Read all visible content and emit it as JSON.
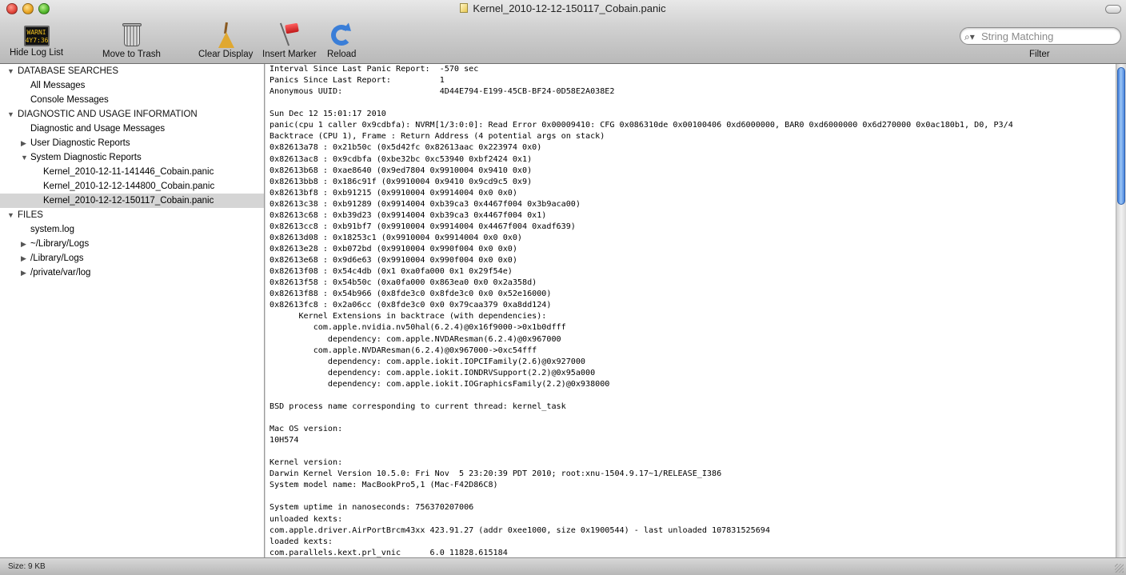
{
  "window": {
    "title": "Kernel_2010-12-12-150117_Cobain.panic"
  },
  "toolbar": {
    "buttons": [
      {
        "label": "Hide Log List",
        "icon": "warning-log-icon",
        "icon_text": "WARNI\n4Y7:36"
      },
      {
        "label": "Move to Trash",
        "icon": "trash-icon"
      },
      {
        "label": "Clear Display",
        "icon": "broom-icon"
      },
      {
        "label": "Insert Marker",
        "icon": "flag-icon"
      },
      {
        "label": "Reload",
        "icon": "reload-icon"
      }
    ],
    "search": {
      "placeholder": "String Matching",
      "value": ""
    },
    "filter_label": "Filter"
  },
  "sidebar": {
    "rows": [
      {
        "label": "DATABASE SEARCHES",
        "kind": "header",
        "expanded": true
      },
      {
        "label": "All Messages",
        "kind": "item"
      },
      {
        "label": "Console Messages",
        "kind": "item"
      },
      {
        "label": "DIAGNOSTIC AND USAGE INFORMATION",
        "kind": "header",
        "expanded": true
      },
      {
        "label": "Diagnostic and Usage Messages",
        "kind": "item"
      },
      {
        "label": "User Diagnostic Reports",
        "kind": "group",
        "expanded": false
      },
      {
        "label": "System Diagnostic Reports",
        "kind": "group",
        "expanded": true
      },
      {
        "label": "Kernel_2010-12-11-141446_Cobain.panic",
        "kind": "file"
      },
      {
        "label": "Kernel_2010-12-12-144800_Cobain.panic",
        "kind": "file"
      },
      {
        "label": "Kernel_2010-12-12-150117_Cobain.panic",
        "kind": "file",
        "selected": true
      },
      {
        "label": "FILES",
        "kind": "header",
        "expanded": true
      },
      {
        "label": "system.log",
        "kind": "item"
      },
      {
        "label": "~/Library/Logs",
        "kind": "group",
        "expanded": false
      },
      {
        "label": "/Library/Logs",
        "kind": "group",
        "expanded": false
      },
      {
        "label": "/private/var/log",
        "kind": "group",
        "expanded": false
      }
    ]
  },
  "log": {
    "lines": [
      "Interval Since Last Panic Report:  -570 sec",
      "Panics Since Last Report:          1",
      "Anonymous UUID:                    4D44E794-E199-45CB-BF24-0D58E2A038E2",
      "",
      "Sun Dec 12 15:01:17 2010",
      "panic(cpu 1 caller 0x9cdbfa): NVRM[1/3:0:0]: Read Error 0x00009410: CFG 0x086310de 0x00100406 0xd6000000, BAR0 0xd6000000 0x6d270000 0x0ac180b1, D0, P3/4",
      "Backtrace (CPU 1), Frame : Return Address (4 potential args on stack)",
      "0x82613a78 : 0x21b50c (0x5d42fc 0x82613aac 0x223974 0x0)",
      "0x82613ac8 : 0x9cdbfa (0xbe32bc 0xc53940 0xbf2424 0x1)",
      "0x82613b68 : 0xae8640 (0x9ed7804 0x9910004 0x9410 0x0)",
      "0x82613bb8 : 0x186c91f (0x9910004 0x9410 0x9cd9c5 0x9)",
      "0x82613bf8 : 0xb91215 (0x9910004 0x9914004 0x0 0x0)",
      "0x82613c38 : 0xb91289 (0x9914004 0xb39ca3 0x4467f004 0x3b9aca00)",
      "0x82613c68 : 0xb39d23 (0x9914004 0xb39ca3 0x4467f004 0x1)",
      "0x82613cc8 : 0xb91bf7 (0x9910004 0x9914004 0x4467f004 0xadf639)",
      "0x82613d08 : 0x18253c1 (0x9910004 0x9914004 0x0 0x0)",
      "0x82613e28 : 0xb072bd (0x9910004 0x990f004 0x0 0x0)",
      "0x82613e68 : 0x9d6e63 (0x9910004 0x990f004 0x0 0x0)",
      "0x82613f08 : 0x54c4db (0x1 0xa0fa000 0x1 0x29f54e)",
      "0x82613f58 : 0x54b50c (0xa0fa000 0x863ea0 0x0 0x2a358d)",
      "0x82613f88 : 0x54b966 (0x8fde3c0 0x8fde3c0 0x0 0x52e16000)",
      "0x82613fc8 : 0x2a06cc (0x8fde3c0 0x0 0x79caa379 0xa8dd124)",
      "      Kernel Extensions in backtrace (with dependencies):",
      "         com.apple.nvidia.nv50hal(6.2.4)@0x16f9000->0x1b0dfff",
      "            dependency: com.apple.NVDAResman(6.2.4)@0x967000",
      "         com.apple.NVDAResman(6.2.4)@0x967000->0xc54fff",
      "            dependency: com.apple.iokit.IOPCIFamily(2.6)@0x927000",
      "            dependency: com.apple.iokit.IONDRVSupport(2.2)@0x95a000",
      "            dependency: com.apple.iokit.IOGraphicsFamily(2.2)@0x938000",
      "",
      "BSD process name corresponding to current thread: kernel_task",
      "",
      "Mac OS version:",
      "10H574",
      "",
      "Kernel version:",
      "Darwin Kernel Version 10.5.0: Fri Nov  5 23:20:39 PDT 2010; root:xnu-1504.9.17~1/RELEASE_I386",
      "System model name: MacBookPro5,1 (Mac-F42D86C8)",
      "",
      "System uptime in nanoseconds: 756370207006",
      "unloaded kexts:",
      "com.apple.driver.AirPortBrcm43xx 423.91.27 (addr 0xee1000, size 0x1900544) - last unloaded 107831525694",
      "loaded kexts:",
      "com.parallels.kext.prl_vnic      6.0 11828.615184"
    ]
  },
  "statusbar": {
    "size_text": "Size: 9 KB"
  }
}
